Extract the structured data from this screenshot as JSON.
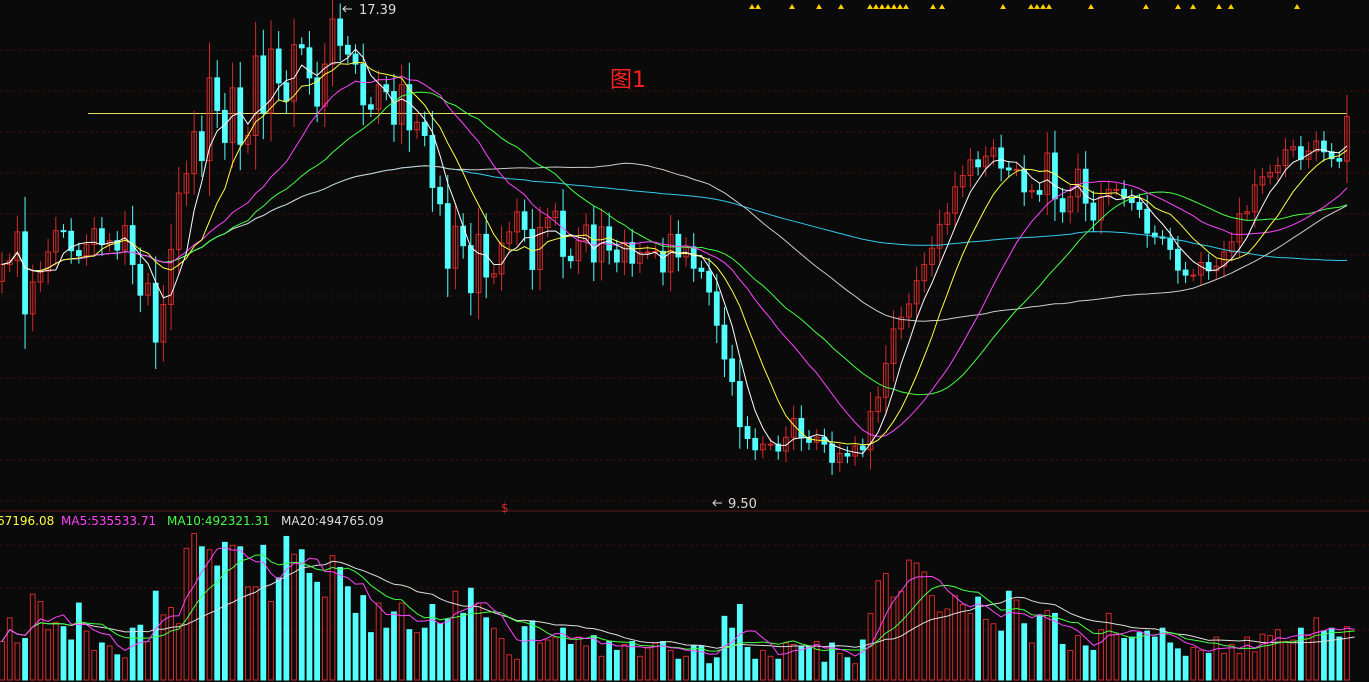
{
  "chart_data": {
    "type": "candlestick",
    "annotation": "图1",
    "price_high": {
      "value": 17.39,
      "label": "17.39"
    },
    "price_low": {
      "value": 9.5,
      "label": "9.50"
    },
    "resistance_level": 15.72,
    "signal_glyph": "$",
    "volume_header": {
      "ma_partial": "67196.08",
      "ma5": "MA5:535533.71",
      "ma10": "MA10:492321.31",
      "ma20": "MA20:494765.09"
    },
    "colors": {
      "background": "#0a0a0a",
      "up": "#d42a2a",
      "down": "#54ffff",
      "ma5_price": "#ffffff",
      "ma10_price": "#ffff44",
      "ma20_price": "#ff44ff",
      "ma30_price": "#44ff44",
      "ma60_price": "#cccccc",
      "ma120_price": "#33ccee",
      "resistance": "#e8e060",
      "signal": "#ffd000",
      "annotation": "#ff2020"
    },
    "closes": [
      13.31,
      13.37,
      13.83,
      12.52,
      13.03,
      13.2,
      13.51,
      13.85,
      13.84,
      13.53,
      13.45,
      13.63,
      13.88,
      13.63,
      13.69,
      13.54,
      13.93,
      13.31,
      12.82,
      13.01,
      12.07,
      12.67,
      13.55,
      14.45,
      14.76,
      15.43,
      14.97,
      16.29,
      15.77,
      15.26,
      16.13,
      15.23,
      15.37,
      16.64,
      15.73,
      16.75,
      16.21,
      15.92,
      16.82,
      16.77,
      16.29,
      15.84,
      16.51,
      17.23,
      16.81,
      16.67,
      16.51,
      15.86,
      15.79,
      16.18,
      16.07,
      15.55,
      16.18,
      15.46,
      15.58,
      15.37,
      14.54,
      14.28,
      13.25,
      13.92,
      13.61,
      12.86,
      13.79,
      13.11,
      13.16,
      13.65,
      13.83,
      14.15,
      13.87,
      13.23,
      13.9,
      14.06,
      14.16,
      13.44,
      13.37,
      13.69,
      13.94,
      13.35,
      13.91,
      13.54,
      13.35,
      13.66,
      13.33,
      13.5,
      13.51,
      13.52,
      13.19,
      13.79,
      13.43,
      13.59,
      13.25,
      13.2,
      12.87,
      12.34,
      11.8,
      11.44,
      10.72,
      10.53,
      10.35,
      10.44,
      10.44,
      10.33,
      10.55,
      10.85,
      10.54,
      10.47,
      10.55,
      10.44,
      10.15,
      10.29,
      10.25,
      10.41,
      10.35,
      10.96,
      11.19,
      11.73,
      12.28,
      12.47,
      12.68,
      13.05,
      13.31,
      13.57,
      13.95,
      14.13,
      14.55,
      14.73,
      14.98,
      14.87,
      15.04,
      15.17,
      14.85,
      14.82,
      14.83,
      14.47,
      14.49,
      14.43,
      15.09,
      14.36,
      14.15,
      14.39,
      14.83,
      14.29,
      14.02,
      14.39,
      14.51,
      14.51,
      14.38,
      14.3,
      14.19,
      13.81,
      13.75,
      13.73,
      13.55,
      13.22,
      13.14,
      13.14,
      13.34,
      13.21,
      13.28,
      13.51,
      13.67,
      14.12,
      14.15,
      14.58,
      14.71,
      14.78,
      14.89,
      15.14,
      15.19,
      14.99,
      15.12,
      15.28,
      15.11,
      15.0,
      14.96,
      15.67
    ],
    "opens": [
      13.04,
      13.31,
      13.37,
      13.83,
      12.52,
      13.03,
      13.2,
      13.51,
      13.85,
      13.84,
      13.53,
      13.45,
      13.63,
      13.88,
      13.63,
      13.69,
      13.54,
      13.93,
      13.31,
      12.82,
      13.01,
      12.07,
      12.67,
      13.55,
      14.45,
      14.76,
      15.43,
      14.97,
      16.29,
      15.77,
      15.26,
      16.13,
      15.23,
      15.37,
      16.64,
      15.73,
      16.75,
      16.21,
      15.92,
      16.82,
      16.77,
      16.29,
      15.84,
      16.51,
      17.23,
      16.81,
      16.67,
      16.51,
      15.86,
      15.79,
      16.18,
      16.07,
      15.55,
      16.18,
      15.46,
      15.58,
      15.37,
      14.54,
      14.28,
      13.25,
      13.92,
      13.61,
      12.86,
      13.79,
      13.11,
      13.16,
      13.65,
      13.83,
      14.15,
      13.87,
      13.23,
      13.9,
      14.06,
      14.16,
      13.44,
      13.37,
      13.69,
      13.94,
      13.35,
      13.91,
      13.54,
      13.35,
      13.66,
      13.33,
      13.5,
      13.51,
      13.52,
      13.19,
      13.79,
      13.43,
      13.59,
      13.25,
      13.2,
      12.87,
      12.34,
      11.8,
      11.44,
      10.72,
      10.53,
      10.35,
      10.44,
      10.44,
      10.33,
      10.55,
      10.85,
      10.54,
      10.47,
      10.55,
      10.44,
      10.15,
      10.29,
      10.25,
      10.41,
      10.35,
      10.96,
      11.19,
      11.73,
      12.28,
      12.47,
      12.68,
      13.05,
      13.31,
      13.57,
      13.95,
      14.13,
      14.55,
      14.73,
      14.98,
      14.87,
      15.04,
      15.17,
      14.85,
      14.82,
      14.83,
      14.47,
      14.49,
      14.43,
      15.09,
      14.36,
      14.15,
      14.39,
      14.83,
      14.29,
      14.02,
      14.39,
      14.51,
      14.51,
      14.38,
      14.3,
      14.19,
      13.81,
      13.75,
      13.73,
      13.55,
      13.22,
      13.14,
      13.14,
      13.34,
      13.21,
      13.28,
      13.51,
      13.67,
      14.12,
      14.15,
      14.58,
      14.71,
      14.78,
      14.89,
      15.14,
      15.19,
      14.99,
      15.12,
      15.28,
      15.11,
      15.0,
      14.96
    ],
    "volumes": [
      0.26,
      0.42,
      0.25,
      0.28,
      0.58,
      0.53,
      0.34,
      0.39,
      0.36,
      0.27,
      0.52,
      0.33,
      0.2,
      0.25,
      0.23,
      0.17,
      0.15,
      0.35,
      0.37,
      0.26,
      0.6,
      0.44,
      0.49,
      0.38,
      0.89,
      0.99,
      0.9,
      0.88,
      0.77,
      0.93,
      0.91,
      0.9,
      0.63,
      0.63,
      0.91,
      0.53,
      0.69,
      0.97,
      0.85,
      0.88,
      0.72,
      0.66,
      0.56,
      0.84,
      0.76,
      0.63,
      0.45,
      0.57,
      0.32,
      0.52,
      0.35,
      0.46,
      0.52,
      0.34,
      0.32,
      0.35,
      0.51,
      0.38,
      0.41,
      0.6,
      0.45,
      0.62,
      0.52,
      0.42,
      0.35,
      0.28,
      0.17,
      0.14,
      0.36,
      0.4,
      0.25,
      0.27,
      0.29,
      0.35,
      0.24,
      0.29,
      0.23,
      0.3,
      0.16,
      0.26,
      0.2,
      0.24,
      0.26,
      0.16,
      0.22,
      0.25,
      0.26,
      0.2,
      0.14,
      0.16,
      0.23,
      0.23,
      0.11,
      0.15,
      0.43,
      0.35,
      0.51,
      0.22,
      0.14,
      0.2,
      0.16,
      0.14,
      0.25,
      0.24,
      0.23,
      0.23,
      0.26,
      0.12,
      0.25,
      0.18,
      0.15,
      0.11,
      0.27,
      0.45,
      0.67,
      0.72,
      0.56,
      0.6,
      0.81,
      0.79,
      0.73,
      0.57,
      0.46,
      0.48,
      0.57,
      0.51,
      0.45,
      0.56,
      0.41,
      0.38,
      0.33,
      0.6,
      0.54,
      0.38,
      0.25,
      0.44,
      0.47,
      0.45,
      0.24,
      0.2,
      0.3,
      0.23,
      0.2,
      0.34,
      0.45,
      0.31,
      0.28,
      0.29,
      0.32,
      0.33,
      0.29,
      0.35,
      0.25,
      0.21,
      0.16,
      0.22,
      0.2,
      0.18,
      0.29,
      0.18,
      0.24,
      0.18,
      0.29,
      0.19,
      0.31,
      0.3,
      0.34,
      0.26,
      0.27,
      0.35,
      0.3,
      0.42,
      0.33,
      0.35,
      0.29,
      0.36,
      0.38
    ]
  }
}
